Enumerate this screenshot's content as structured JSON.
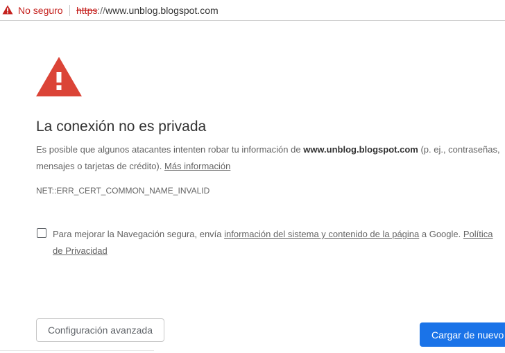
{
  "address_bar": {
    "security_label": "No seguro",
    "url_scheme": "https",
    "url_separator": "://",
    "url_host": "www.unblog.blogspot.com"
  },
  "main": {
    "title": "La conexión no es privada",
    "explanation_before": "Es posible que algunos atacantes intenten robar tu información de ",
    "explanation_domain": "www.unblog.blogspot.com",
    "explanation_after": " (p. ej., contraseñas, mensajes o tarjetas de crédito). ",
    "learn_more_link": "Más información",
    "error_code": "NET::ERR_CERT_COMMON_NAME_INVALID",
    "opt_in_before": "Para mejorar la Navegación segura, envía ",
    "opt_in_link": "información del sistema y contenido de la página",
    "opt_in_middle": " a Google. ",
    "privacy_link": "Política de Privacidad",
    "checkbox_checked": false
  },
  "buttons": {
    "advanced_label": "Configuración avanzada",
    "reload_label": "Cargar de nuevo"
  },
  "icons": {
    "address_warning": "warning-triangle-icon",
    "main_warning": "warning-triangle-icon"
  },
  "colors": {
    "danger": "#c5221f",
    "warning_icon": "#db4437",
    "primary_button": "#1a73e8",
    "body_text": "#646464",
    "title_text": "#333333"
  }
}
